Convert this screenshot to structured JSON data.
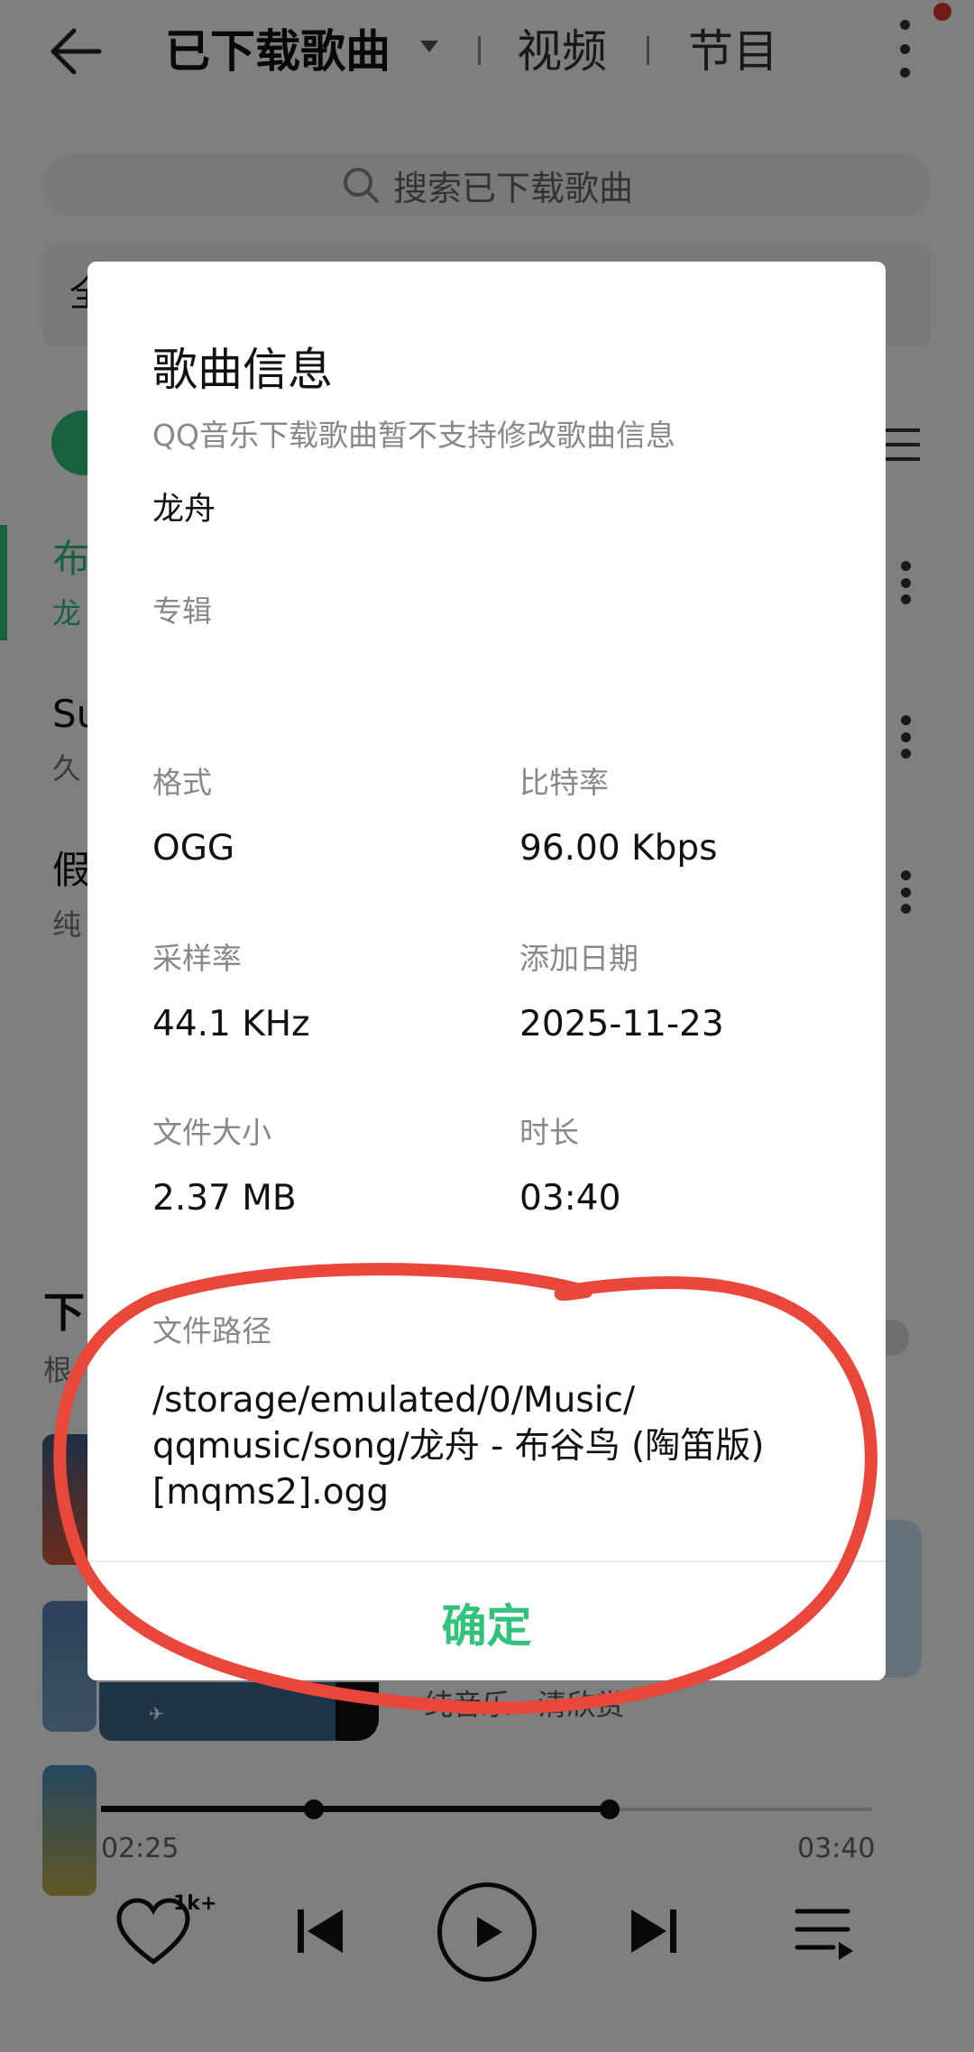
{
  "header": {
    "title": "已下载歌曲",
    "tabs": [
      {
        "label": "视频"
      },
      {
        "label": "节目"
      }
    ]
  },
  "search": {
    "placeholder": "搜索已下载歌曲"
  },
  "filter": {
    "label": "全"
  },
  "songs": [
    {
      "title": "布",
      "sub": "龙"
    },
    {
      "title": "Su",
      "sub": "久"
    },
    {
      "title": "假",
      "sub": "纯"
    }
  ],
  "section": {
    "title": "下",
    "sub": "根"
  },
  "now_playing_card": {
    "sub": "纯音乐 · 清欣赏"
  },
  "player": {
    "elapsed": "02:25",
    "duration": "03:40",
    "progress": 0.66,
    "like_count": "1k+"
  },
  "dialog": {
    "title": "歌曲信息",
    "note": "QQ音乐下载歌曲暂不支持修改歌曲信息",
    "artist": "龙舟",
    "album_label": "专辑",
    "album_value": "",
    "fields": [
      {
        "label": "格式",
        "value": "OGG"
      },
      {
        "label": "比特率",
        "value": "96.00 Kbps"
      },
      {
        "label": "采样率",
        "value": "44.1 KHz"
      },
      {
        "label": "添加日期",
        "value": "2025-11-23"
      },
      {
        "label": "文件大小",
        "value": "2.37 MB"
      },
      {
        "label": "时长",
        "value": "03:40"
      }
    ],
    "path_label": "文件路径",
    "path_value": "/storage/emulated/0/Music/\nqqmusic/song/龙舟 - 布谷鸟 (陶笛版)\n[mqms2].ogg",
    "confirm_label": "确定"
  },
  "colors": {
    "accent": "#31c27c",
    "annotation": "#e8473a"
  }
}
